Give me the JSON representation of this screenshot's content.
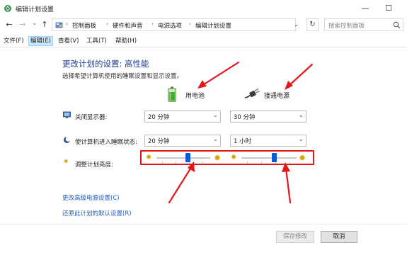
{
  "window": {
    "title": "编辑计划设置",
    "minimize_glyph": "—",
    "maximize_glyph": "☐",
    "close_glyph": "✕"
  },
  "nav": {
    "back_glyph": "←",
    "forward_glyph": "→",
    "recent_glyph": "⌄",
    "up_glyph": "↑",
    "breadcrumbs": [
      "控制面板",
      "硬件和声音",
      "电源选项",
      "编辑计划设置"
    ],
    "separator": "›",
    "dropdown_glyph": "⌄",
    "refresh_glyph": "↻",
    "search_placeholder": "搜索控制面板"
  },
  "menu": [
    "文件(F)",
    "编辑(E)",
    "查看(V)",
    "工具(T)",
    "帮助(H)"
  ],
  "plan": {
    "heading": "更改计划的设置: 高性能",
    "subtitle": "选择希望计算机使用的睡眠设置和显示设置。",
    "battery_label": "用电池",
    "plugged_label": "接通电源"
  },
  "settings": {
    "display": {
      "label": "关闭显示器:",
      "battery_value": "20 分钟",
      "plugged_value": "30 分钟"
    },
    "sleep": {
      "label": "使计算机进入睡眠状态:",
      "battery_value": "20 分钟",
      "plugged_value": "1 小时"
    },
    "brightness": {
      "label": "调整计划亮度:",
      "battery_level": 0.6,
      "plugged_level": 0.6
    }
  },
  "links": {
    "advanced": "更改高级电源设置(C)",
    "restore": "还原此计划的默认设置(R)"
  },
  "buttons": {
    "save": "保存修改",
    "cancel": "取消"
  },
  "colors": {
    "heading": "#1f3d99",
    "link": "#1f5bbd",
    "slider_thumb": "#0a5bd7",
    "annotation": "#e3161a",
    "menu_highlight": "#cce8ff"
  },
  "icons": {
    "app": "power-options-icon",
    "battery": "battery-icon",
    "plug": "power-plug-icon",
    "display": "monitor-icon",
    "sleep": "moon-icon",
    "brightness": "sun-icon",
    "search": "search-icon"
  }
}
